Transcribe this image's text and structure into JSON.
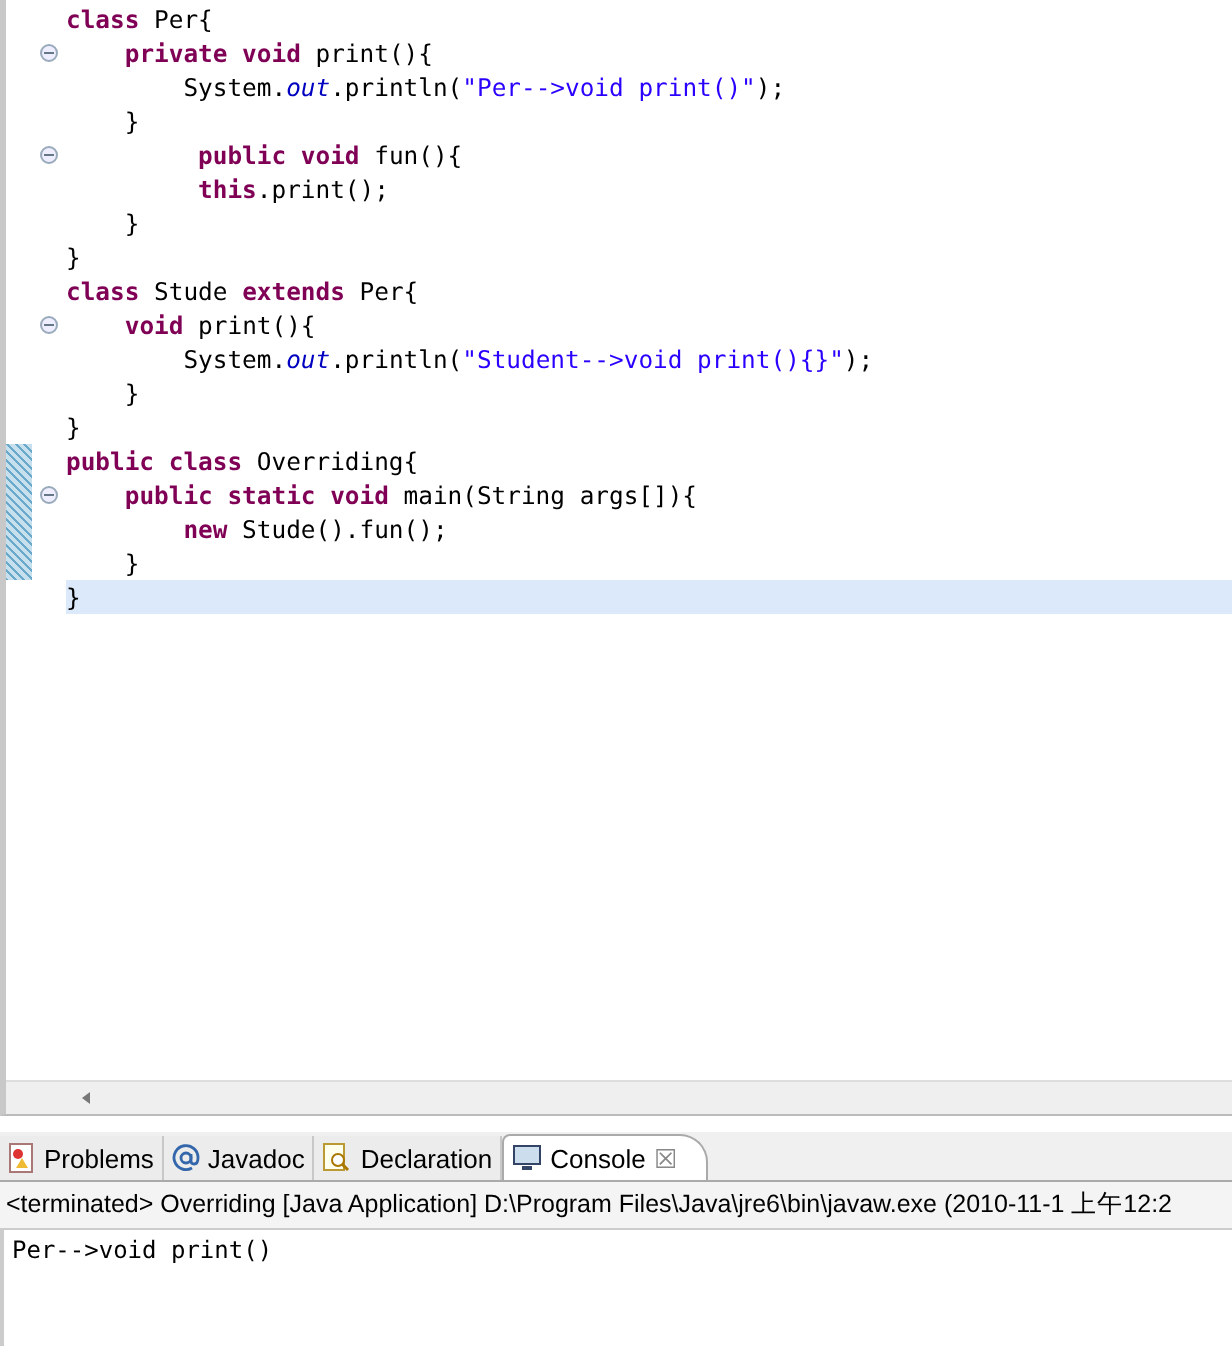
{
  "editor": {
    "lines": [
      {
        "fold": false,
        "changed": false,
        "current": false,
        "tokens": [
          {
            "kind": "kw",
            "text": "class"
          },
          {
            "kind": "plain",
            "text": " Per{"
          }
        ]
      },
      {
        "fold": true,
        "changed": false,
        "current": false,
        "tokens": [
          {
            "kind": "kw",
            "text": "    private void"
          },
          {
            "kind": "plain",
            "text": " print(){"
          }
        ]
      },
      {
        "fold": false,
        "changed": false,
        "current": false,
        "tokens": [
          {
            "kind": "plain",
            "text": "        System."
          },
          {
            "kind": "field",
            "text": "out"
          },
          {
            "kind": "plain",
            "text": ".println("
          },
          {
            "kind": "string",
            "text": "\"Per-->void print()\""
          },
          {
            "kind": "plain",
            "text": ");"
          }
        ]
      },
      {
        "fold": false,
        "changed": false,
        "current": false,
        "tokens": [
          {
            "kind": "plain",
            "text": "    }"
          }
        ]
      },
      {
        "fold": true,
        "changed": false,
        "current": false,
        "tokens": [
          {
            "kind": "kw",
            "text": "         public void"
          },
          {
            "kind": "plain",
            "text": " fun(){"
          }
        ]
      },
      {
        "fold": false,
        "changed": false,
        "current": false,
        "tokens": [
          {
            "kind": "kw",
            "text": "         this"
          },
          {
            "kind": "plain",
            "text": ".print();"
          }
        ]
      },
      {
        "fold": false,
        "changed": false,
        "current": false,
        "tokens": [
          {
            "kind": "plain",
            "text": "    }"
          }
        ]
      },
      {
        "fold": false,
        "changed": false,
        "current": false,
        "tokens": [
          {
            "kind": "plain",
            "text": "}"
          }
        ]
      },
      {
        "fold": false,
        "changed": false,
        "current": false,
        "tokens": [
          {
            "kind": "kw",
            "text": "class"
          },
          {
            "kind": "plain",
            "text": " Stude "
          },
          {
            "kind": "kw",
            "text": "extends"
          },
          {
            "kind": "plain",
            "text": " Per{"
          }
        ]
      },
      {
        "fold": true,
        "changed": false,
        "current": false,
        "tokens": [
          {
            "kind": "kw",
            "text": "    void"
          },
          {
            "kind": "plain",
            "text": " print(){"
          }
        ]
      },
      {
        "fold": false,
        "changed": false,
        "current": false,
        "tokens": [
          {
            "kind": "plain",
            "text": "        System."
          },
          {
            "kind": "field",
            "text": "out"
          },
          {
            "kind": "plain",
            "text": ".println("
          },
          {
            "kind": "string",
            "text": "\"Student-->void print(){}\""
          },
          {
            "kind": "plain",
            "text": ");"
          }
        ]
      },
      {
        "fold": false,
        "changed": false,
        "current": false,
        "tokens": [
          {
            "kind": "plain",
            "text": "    }"
          }
        ]
      },
      {
        "fold": false,
        "changed": false,
        "current": false,
        "tokens": [
          {
            "kind": "plain",
            "text": "}"
          }
        ]
      },
      {
        "fold": false,
        "changed": true,
        "current": false,
        "tokens": [
          {
            "kind": "kw",
            "text": "public class"
          },
          {
            "kind": "plain",
            "text": " Overriding{"
          }
        ]
      },
      {
        "fold": true,
        "changed": true,
        "current": false,
        "tokens": [
          {
            "kind": "kw",
            "text": "    public static void"
          },
          {
            "kind": "plain",
            "text": " main(String args[]){"
          }
        ]
      },
      {
        "fold": false,
        "changed": true,
        "current": false,
        "tokens": [
          {
            "kind": "kw",
            "text": "        new"
          },
          {
            "kind": "plain",
            "text": " Stude().fun();"
          }
        ]
      },
      {
        "fold": false,
        "changed": true,
        "current": false,
        "tokens": [
          {
            "kind": "plain",
            "text": "    }"
          }
        ]
      },
      {
        "fold": false,
        "changed": false,
        "current": true,
        "tokens": [
          {
            "kind": "plain",
            "text": "}"
          }
        ]
      }
    ]
  },
  "tabs": [
    {
      "label": "Problems",
      "selected": false
    },
    {
      "label": "Javadoc",
      "selected": false
    },
    {
      "label": "Declaration",
      "selected": false
    },
    {
      "label": "Console",
      "selected": true,
      "close": "☒"
    }
  ],
  "console": {
    "status": "<terminated> Overriding [Java Application] D:\\Program Files\\Java\\jre6\\bin\\javaw.exe (2010-11-1 上午12:2",
    "output": "Per-->void print()"
  }
}
